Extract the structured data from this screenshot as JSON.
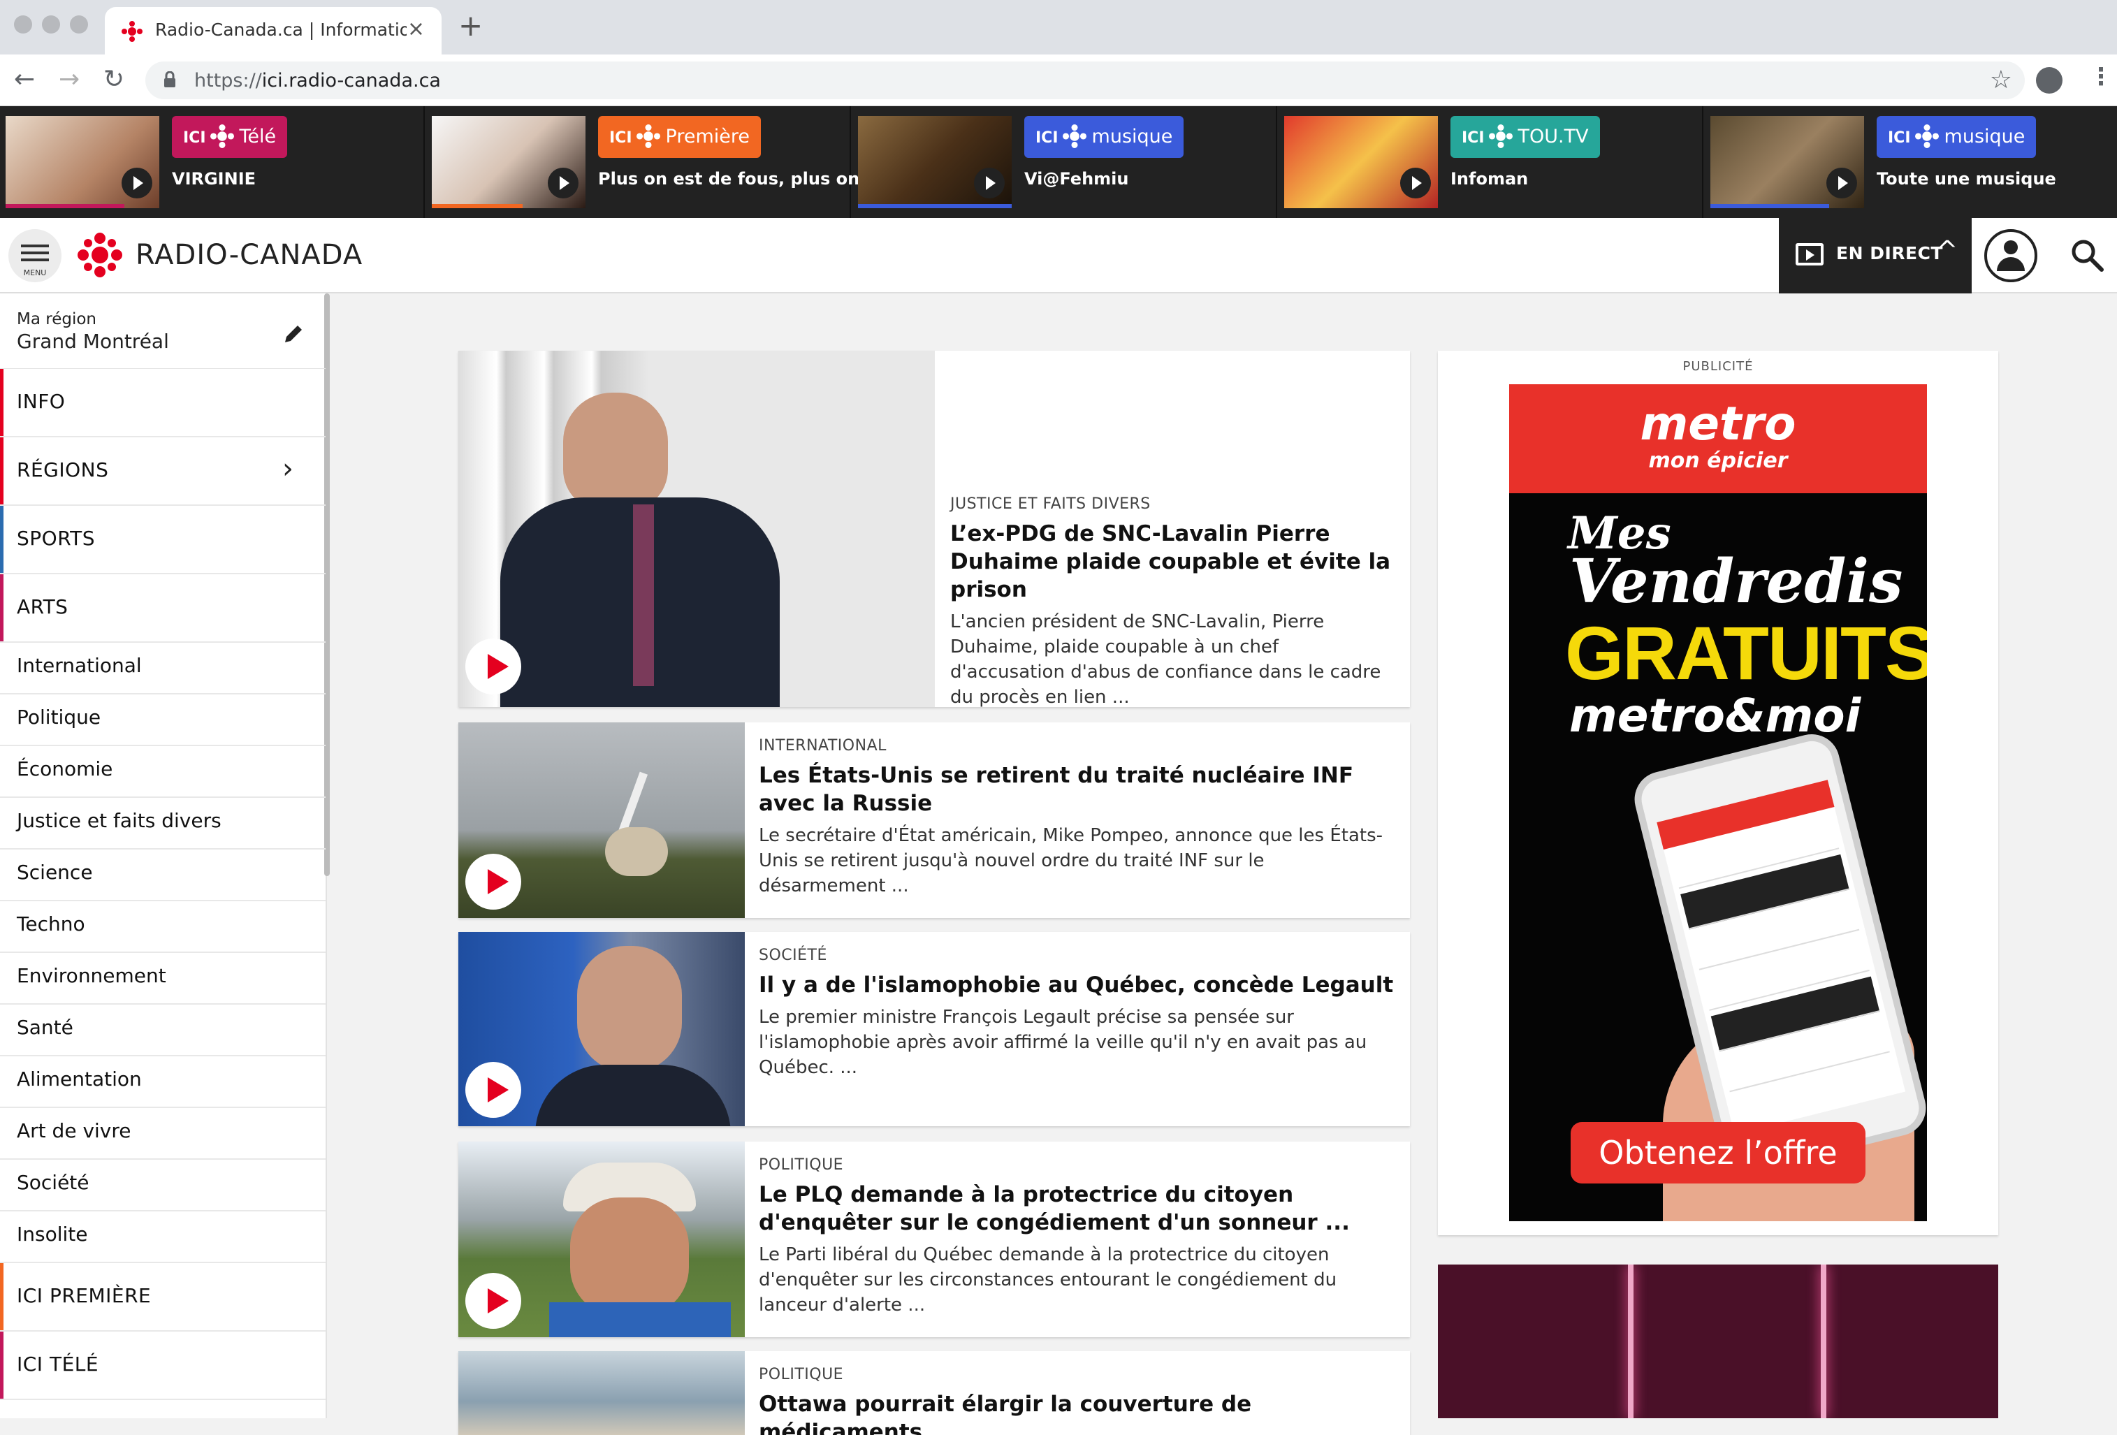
{
  "browser": {
    "tab_title": "Radio-Canada.ca | Information",
    "tab_close": "×",
    "new_tab": "+",
    "url_scheme": "https://",
    "url_host": "ici.radio-canada.ca",
    "back": "←",
    "forward": "→",
    "reload": "↻",
    "bookmark": "☆",
    "menu": "⋮"
  },
  "promos": [
    {
      "ici": "ICI",
      "network": "Télé",
      "title": "VIRGINIE",
      "color": "#c2185b"
    },
    {
      "ici": "ICI",
      "network": "Première",
      "title": "Plus on est de fous, plus on lit !",
      "color": "#f26722"
    },
    {
      "ici": "ICI",
      "network": "musique",
      "title": "Vi@Fehmiu",
      "color": "#3b5bdb"
    },
    {
      "ici": "ICI",
      "network": "TOU.TV",
      "title": "Infoman",
      "color": "#26a69a"
    },
    {
      "ici": "ICI",
      "network": "musique",
      "title": "Toute une musique",
      "color": "#3b5bdb"
    }
  ],
  "header": {
    "menu_label": "MENU",
    "logo": "RADIO-CANADA",
    "live_label": "EN DIRECT",
    "live_chevron": "^"
  },
  "sidebar": {
    "region_label": "Ma région",
    "region_value": "Grand Montréal",
    "items": [
      {
        "label": "INFO",
        "color": "#e4001f"
      },
      {
        "label": "RÉGIONS",
        "color": "#e4001f"
      },
      {
        "label": "SPORTS",
        "color": "#2b6cb0"
      },
      {
        "label": "ARTS",
        "color": "#c2185b"
      }
    ],
    "sub_items": [
      "International",
      "Politique",
      "Économie",
      "Justice et faits divers",
      "Science",
      "Techno",
      "Environnement",
      "Santé",
      "Alimentation",
      "Art de vivre",
      "Société",
      "Insolite"
    ],
    "bottom_items": [
      {
        "label": "ICI PREMIÈRE",
        "color": "#f26722"
      },
      {
        "label": "ICI TÉLÉ",
        "color": "#c2185b"
      }
    ],
    "chevron": "›"
  },
  "articles": [
    {
      "category": "JUSTICE ET FAITS DIVERS",
      "title": "L’ex-PDG de SNC-Lavalin Pierre Duhaime plaide coupable et évite la prison",
      "summary": "L'ancien président de SNC-Lavalin, Pierre Duhaime, plaide coupable à un chef d'accusation d'abus de confiance dans le cadre du procès en lien ..."
    },
    {
      "category": "INTERNATIONAL",
      "title": "Les États-Unis se retirent du traité nucléaire INF avec la Russie",
      "summary": "Le secrétaire d'État américain, Mike Pompeo, annonce que les États-Unis se retirent jusqu'à nouvel ordre du traité INF sur le désarmement ..."
    },
    {
      "category": "SOCIÉTÉ",
      "title": "Il y a de l'islamophobie au Québec, concède Legault",
      "summary": "Le premier ministre François Legault précise sa pensée sur l'islamophobie après avoir affirmé la veille qu'il n'y en avait pas au Québec. ..."
    },
    {
      "category": "POLITIQUE",
      "title": "Le PLQ demande à la protectrice du citoyen d'enquêter sur le congédiement d'un sonneur ...",
      "summary": "Le Parti libéral du Québec demande à la protectrice du citoyen d'enquêter sur les circonstances entourant le congédiement du lanceur d'alerte ..."
    },
    {
      "category": "POLITIQUE",
      "title": "Ottawa pourrait élargir la couverture de médicaments",
      "summary": ""
    }
  ],
  "ad": {
    "label": "PUBLICITÉ",
    "brand": "metro",
    "brand_sub": "mon épicier",
    "line1": "Mes",
    "line2": "Vendredis",
    "line3": "GRATUITS!",
    "line4": "metro&moi",
    "cta": "Obtenez l’offre"
  }
}
